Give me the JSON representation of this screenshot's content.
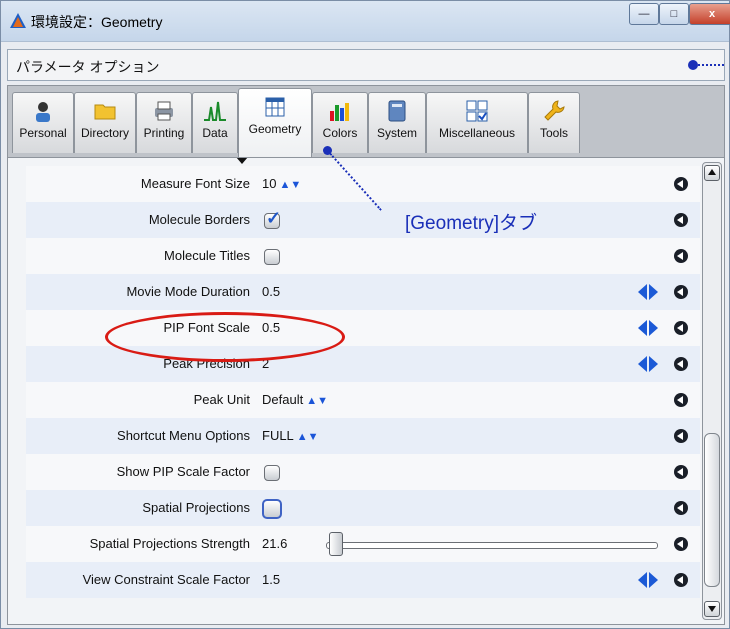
{
  "window": {
    "title": "環境設定：Geometry",
    "controls": {
      "minimize": "—",
      "maximize": "□",
      "close": "x"
    }
  },
  "menubar": {
    "text": "パラメータ オプション"
  },
  "tabs": [
    {
      "label": "Personal",
      "icon": "person-icon"
    },
    {
      "label": "Directory",
      "icon": "folder-icon"
    },
    {
      "label": "Printing",
      "icon": "printer-icon"
    },
    {
      "label": "Data",
      "icon": "spectrum-icon"
    },
    {
      "label": "Geometry",
      "icon": "grid-window-icon",
      "active": true
    },
    {
      "label": "Colors",
      "icon": "color-bars-icon"
    },
    {
      "label": "System",
      "icon": "system-icon"
    },
    {
      "label": "Miscellaneous",
      "icon": "checklist-icon"
    },
    {
      "label": "Tools",
      "icon": "wrench-icon"
    }
  ],
  "settings": [
    {
      "label": "Measure Font Size",
      "value": "10",
      "control": "dropdown"
    },
    {
      "label": "Molecule Borders",
      "control": "checkbox",
      "checked": true
    },
    {
      "label": "Molecule Titles",
      "control": "checkbox",
      "checked": false
    },
    {
      "label": "Movie Mode Duration",
      "value": "0.5",
      "control": "stepper"
    },
    {
      "label": "PIP Font Scale",
      "value": "0.5",
      "control": "stepper"
    },
    {
      "label": "Peak Precision",
      "value": "2",
      "control": "stepper"
    },
    {
      "label": "Peak Unit",
      "value": "Default",
      "control": "dropdown"
    },
    {
      "label": "Shortcut Menu Options",
      "value": "FULL",
      "control": "dropdown"
    },
    {
      "label": "Show PIP Scale Factor",
      "control": "checkbox",
      "checked": false
    },
    {
      "label": "Spatial Projections",
      "control": "checkbox",
      "checked": false
    },
    {
      "label": "Spatial Projections Strength",
      "value": "21.6",
      "control": "slider",
      "slider_fraction": 0.02
    },
    {
      "label": "View Constraint Scale Factor",
      "value": "1.5",
      "control": "stepper"
    }
  ],
  "annotation": {
    "text": "[Geometry]タブ"
  },
  "colors": {
    "annotation": "#1a2fb8",
    "highlight_ellipse": "#d91b14",
    "stepper": "#1c5ad6"
  }
}
